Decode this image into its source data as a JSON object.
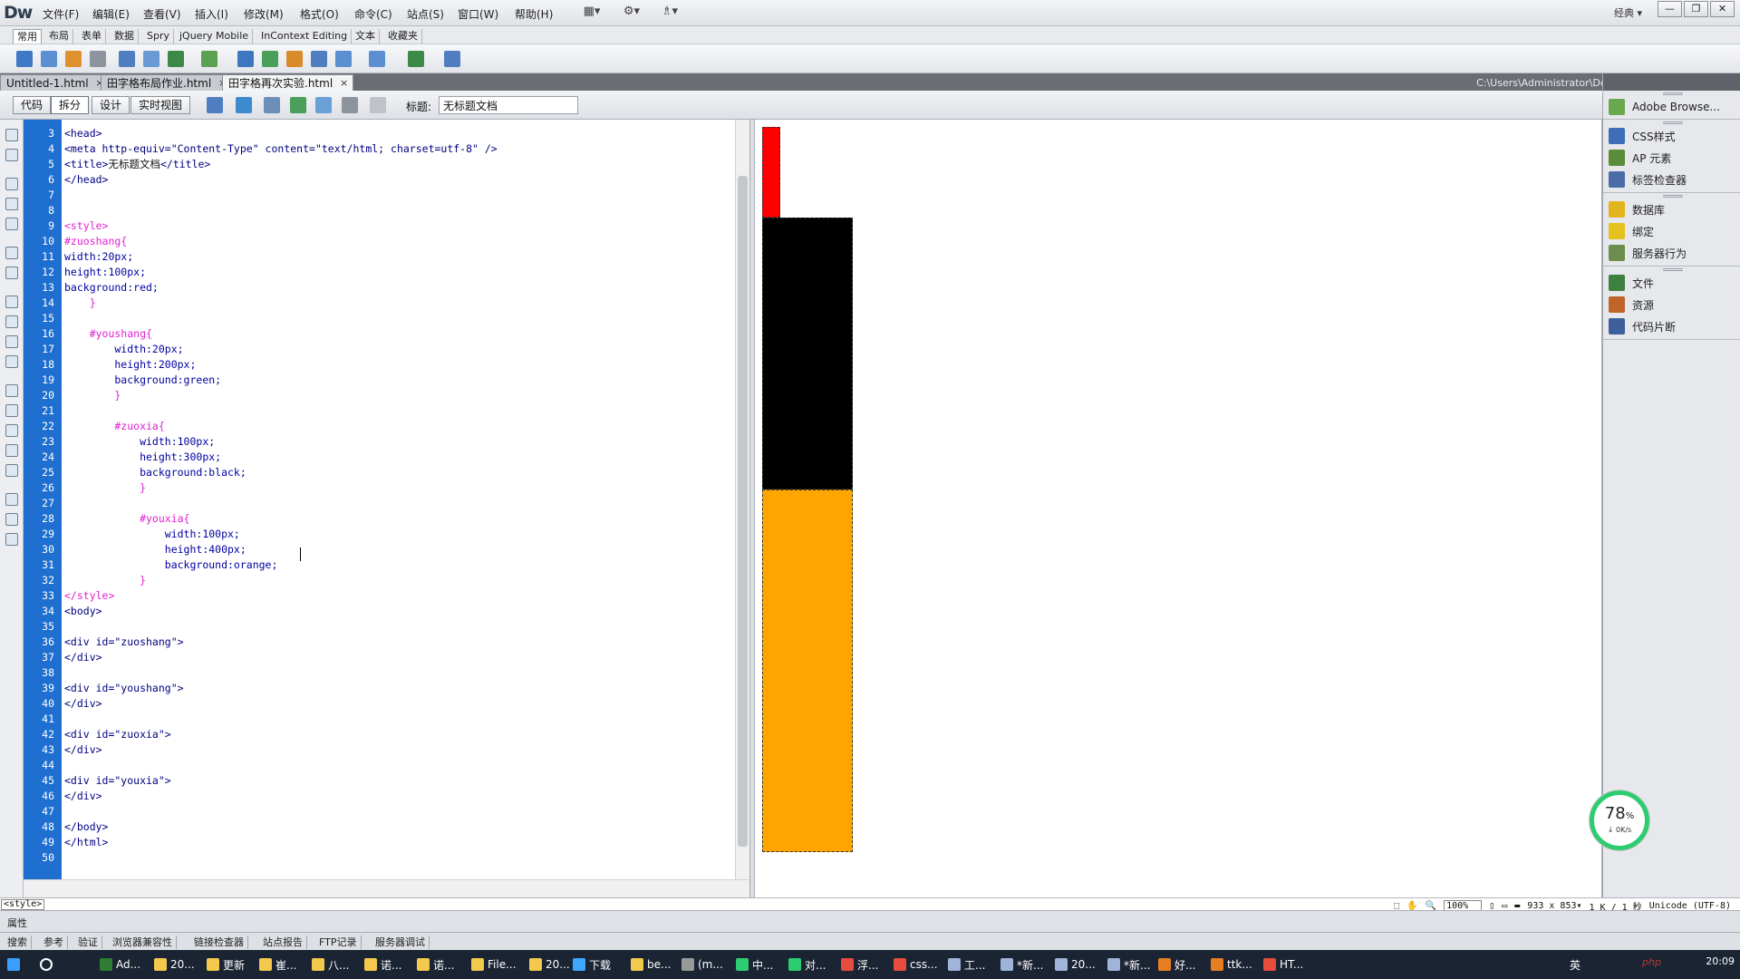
{
  "app": {
    "logo": "Dw",
    "workspace": "经典 ▾"
  },
  "menu": [
    "文件(F)",
    "编辑(E)",
    "查看(V)",
    "插入(I)",
    "修改(M)",
    "格式(O)",
    "命令(C)",
    "站点(S)",
    "窗口(W)",
    "帮助(H)"
  ],
  "menu_tools": [
    "▦▾",
    "⚙▾",
    "♗▾"
  ],
  "window_controls": [
    "—",
    "❐",
    "✕"
  ],
  "insert_tabs": [
    "常用",
    "布局",
    "表单",
    "数据",
    "Spry",
    "jQuery Mobile",
    "InContext Editing",
    "文本",
    "收藏夹"
  ],
  "doc_tabs": [
    {
      "label": "Untitled-1.html",
      "close": "×"
    },
    {
      "label": "田字格布局作业.html",
      "close": "×"
    },
    {
      "label": "田字格再次实验.html",
      "close": "×"
    }
  ],
  "doc_path": "C:\\Users\\Administrator\\Desktop\\田字格再次实验.html",
  "doc_toolbar": {
    "views": [
      "代码",
      "拆分",
      "设计",
      "实时视图"
    ],
    "title_label": "标题:",
    "title_value": "无标题文档"
  },
  "code_lines": [
    {
      "n": "3",
      "parts": [
        {
          "t": "<head>",
          "c": "navy"
        }
      ]
    },
    {
      "n": "4",
      "parts": [
        {
          "t": "<meta http-equiv=\"Content-Type\" content=\"text/html; charset=utf-8\" />",
          "c": "navy"
        }
      ]
    },
    {
      "n": "5",
      "parts": [
        {
          "t": "<title>",
          "c": "navy"
        },
        {
          "t": "无标题文档",
          "c": "dark"
        },
        {
          "t": "</title>",
          "c": "navy"
        }
      ]
    },
    {
      "n": "6",
      "parts": [
        {
          "t": "</head>",
          "c": "navy"
        }
      ]
    },
    {
      "n": "7",
      "parts": []
    },
    {
      "n": "8",
      "parts": []
    },
    {
      "n": "9",
      "parts": [
        {
          "t": "<style>",
          "c": "pink"
        }
      ]
    },
    {
      "n": "10",
      "parts": [
        {
          "t": "#zuoshang{",
          "c": "pink"
        }
      ]
    },
    {
      "n": "11",
      "parts": [
        {
          "t": "width:20px;",
          "c": "blue"
        }
      ]
    },
    {
      "n": "12",
      "parts": [
        {
          "t": "height:100px;",
          "c": "blue"
        }
      ]
    },
    {
      "n": "13",
      "parts": [
        {
          "t": "background:red;",
          "c": "blue"
        }
      ]
    },
    {
      "n": "14",
      "parts": [
        {
          "t": "    }",
          "c": "pink"
        }
      ]
    },
    {
      "n": "15",
      "parts": []
    },
    {
      "n": "16",
      "parts": [
        {
          "t": "    #youshang{",
          "c": "pink"
        }
      ]
    },
    {
      "n": "17",
      "parts": [
        {
          "t": "        width:20px;",
          "c": "blue"
        }
      ]
    },
    {
      "n": "18",
      "parts": [
        {
          "t": "        height:200px;",
          "c": "blue"
        }
      ]
    },
    {
      "n": "19",
      "parts": [
        {
          "t": "        background:green;",
          "c": "blue"
        }
      ]
    },
    {
      "n": "20",
      "parts": [
        {
          "t": "        }",
          "c": "pink"
        }
      ]
    },
    {
      "n": "21",
      "parts": []
    },
    {
      "n": "22",
      "parts": [
        {
          "t": "        #zuoxia{",
          "c": "pink"
        }
      ]
    },
    {
      "n": "23",
      "parts": [
        {
          "t": "            width:100px;",
          "c": "blue"
        }
      ]
    },
    {
      "n": "24",
      "parts": [
        {
          "t": "            height:300px;",
          "c": "blue"
        }
      ]
    },
    {
      "n": "25",
      "parts": [
        {
          "t": "            background:black;",
          "c": "blue"
        }
      ]
    },
    {
      "n": "26",
      "parts": [
        {
          "t": "            }",
          "c": "pink"
        }
      ]
    },
    {
      "n": "27",
      "parts": []
    },
    {
      "n": "28",
      "parts": [
        {
          "t": "            #youxia{",
          "c": "pink"
        }
      ]
    },
    {
      "n": "29",
      "parts": [
        {
          "t": "                width:100px;",
          "c": "blue"
        }
      ]
    },
    {
      "n": "30",
      "parts": [
        {
          "t": "                height:400px;",
          "c": "blue"
        }
      ]
    },
    {
      "n": "31",
      "parts": [
        {
          "t": "                background:orange;",
          "c": "blue"
        }
      ]
    },
    {
      "n": "32",
      "parts": [
        {
          "t": "            }",
          "c": "pink"
        }
      ]
    },
    {
      "n": "33",
      "parts": [
        {
          "t": "</style>",
          "c": "pink"
        }
      ]
    },
    {
      "n": "34",
      "parts": [
        {
          "t": "<body>",
          "c": "navy"
        }
      ]
    },
    {
      "n": "35",
      "parts": []
    },
    {
      "n": "36",
      "parts": [
        {
          "t": "<div id=\"zuoshang\">",
          "c": "navy"
        }
      ]
    },
    {
      "n": "37",
      "parts": [
        {
          "t": "</div>",
          "c": "navy"
        }
      ]
    },
    {
      "n": "38",
      "parts": []
    },
    {
      "n": "39",
      "parts": [
        {
          "t": "<div id=\"youshang\">",
          "c": "navy"
        }
      ]
    },
    {
      "n": "40",
      "parts": [
        {
          "t": "</div>",
          "c": "navy"
        }
      ]
    },
    {
      "n": "41",
      "parts": []
    },
    {
      "n": "42",
      "parts": [
        {
          "t": "<div id=\"zuoxia\">",
          "c": "navy"
        }
      ]
    },
    {
      "n": "43",
      "parts": [
        {
          "t": "</div>",
          "c": "navy"
        }
      ]
    },
    {
      "n": "44",
      "parts": []
    },
    {
      "n": "45",
      "parts": [
        {
          "t": "<div id=\"youxia\">",
          "c": "navy"
        }
      ]
    },
    {
      "n": "46",
      "parts": [
        {
          "t": "</div>",
          "c": "navy"
        }
      ]
    },
    {
      "n": "47",
      "parts": []
    },
    {
      "n": "48",
      "parts": [
        {
          "t": "</body>",
          "c": "navy"
        }
      ]
    },
    {
      "n": "49",
      "parts": [
        {
          "t": "</html>",
          "c": "navy"
        }
      ]
    },
    {
      "n": "50",
      "parts": []
    }
  ],
  "preview_colors": {
    "zuoshang": "#ff0000",
    "zuoxia": "#000000",
    "youxia": "#ffa500"
  },
  "panel": {
    "group1": [
      {
        "label": "Adobe Browse...",
        "icon": "browser-lab-icon",
        "color": "#6aa84f"
      }
    ],
    "group2": [
      {
        "label": "CSS样式",
        "icon": "css-styles-icon",
        "color": "#3d6fb6"
      },
      {
        "label": "AP 元素",
        "icon": "ap-elements-icon",
        "color": "#5b8c3a"
      },
      {
        "label": "标签检查器",
        "icon": "tag-inspector-icon",
        "color": "#4a6da7"
      }
    ],
    "group3": [
      {
        "label": "数据库",
        "icon": "database-icon",
        "color": "#e3b51d"
      },
      {
        "label": "绑定",
        "icon": "bindings-icon",
        "color": "#e3c21d"
      },
      {
        "label": "服务器行为",
        "icon": "server-behaviors-icon",
        "color": "#6b8e4e"
      }
    ],
    "group4": [
      {
        "label": "文件",
        "icon": "files-icon",
        "color": "#3f7f3f"
      },
      {
        "label": "资源",
        "icon": "assets-icon",
        "color": "#c0642a"
      },
      {
        "label": "代码片断",
        "icon": "snippets-icon",
        "color": "#3d5f9a"
      }
    ]
  },
  "status": {
    "tag": "<style>",
    "zoom": "100%",
    "dims": "933 x 853▾",
    "size": "1 K / 1 秒",
    "encoding": "Unicode (UTF-8)"
  },
  "properties_label": "属性",
  "results_tabs": [
    "搜索",
    "参考",
    "验证",
    "浏览器兼容性",
    "链接检查器",
    "站点报告",
    "FTP记录",
    "服务器调试"
  ],
  "taskbar": [
    {
      "label": "Ad...",
      "color": "#2e7d32"
    },
    {
      "label": "20...",
      "color": "#f2c94c"
    },
    {
      "label": "更新",
      "color": "#f2c94c"
    },
    {
      "label": "崔...",
      "color": "#f2c94c"
    },
    {
      "label": "八...",
      "color": "#f2c94c"
    },
    {
      "label": "诺...",
      "color": "#f2c94c"
    },
    {
      "label": "诺...",
      "color": "#f2c94c"
    },
    {
      "label": "File...",
      "color": "#f2c94c"
    },
    {
      "label": "20...",
      "color": "#f2c94c"
    },
    {
      "label": "下载",
      "color": "#3fa7ff"
    },
    {
      "label": "be...",
      "color": "#f2c94c"
    },
    {
      "label": "(m...",
      "color": "#999999"
    },
    {
      "label": "中...",
      "color": "#2ecc71"
    },
    {
      "label": "对...",
      "color": "#2ecc71"
    },
    {
      "label": "浮...",
      "color": "#e74c3c"
    },
    {
      "label": "css...",
      "color": "#e74c3c"
    },
    {
      "label": "工...",
      "color": "#9fb4d8"
    },
    {
      "label": "*新...",
      "color": "#9fb4d8"
    },
    {
      "label": "20...",
      "color": "#9fb4d8"
    },
    {
      "label": "*新...",
      "color": "#9fb4d8"
    },
    {
      "label": "好...",
      "color": "#e67e22"
    },
    {
      "label": "ttk...",
      "color": "#e67e22"
    },
    {
      "label": "HT...",
      "color": "#e74c3c"
    }
  ],
  "tray": {
    "ime": "英",
    "clock": "20:09"
  },
  "gauge": {
    "value": "78",
    "unit": "%",
    "speed": "↓ 0K/s"
  },
  "watermark": "php"
}
